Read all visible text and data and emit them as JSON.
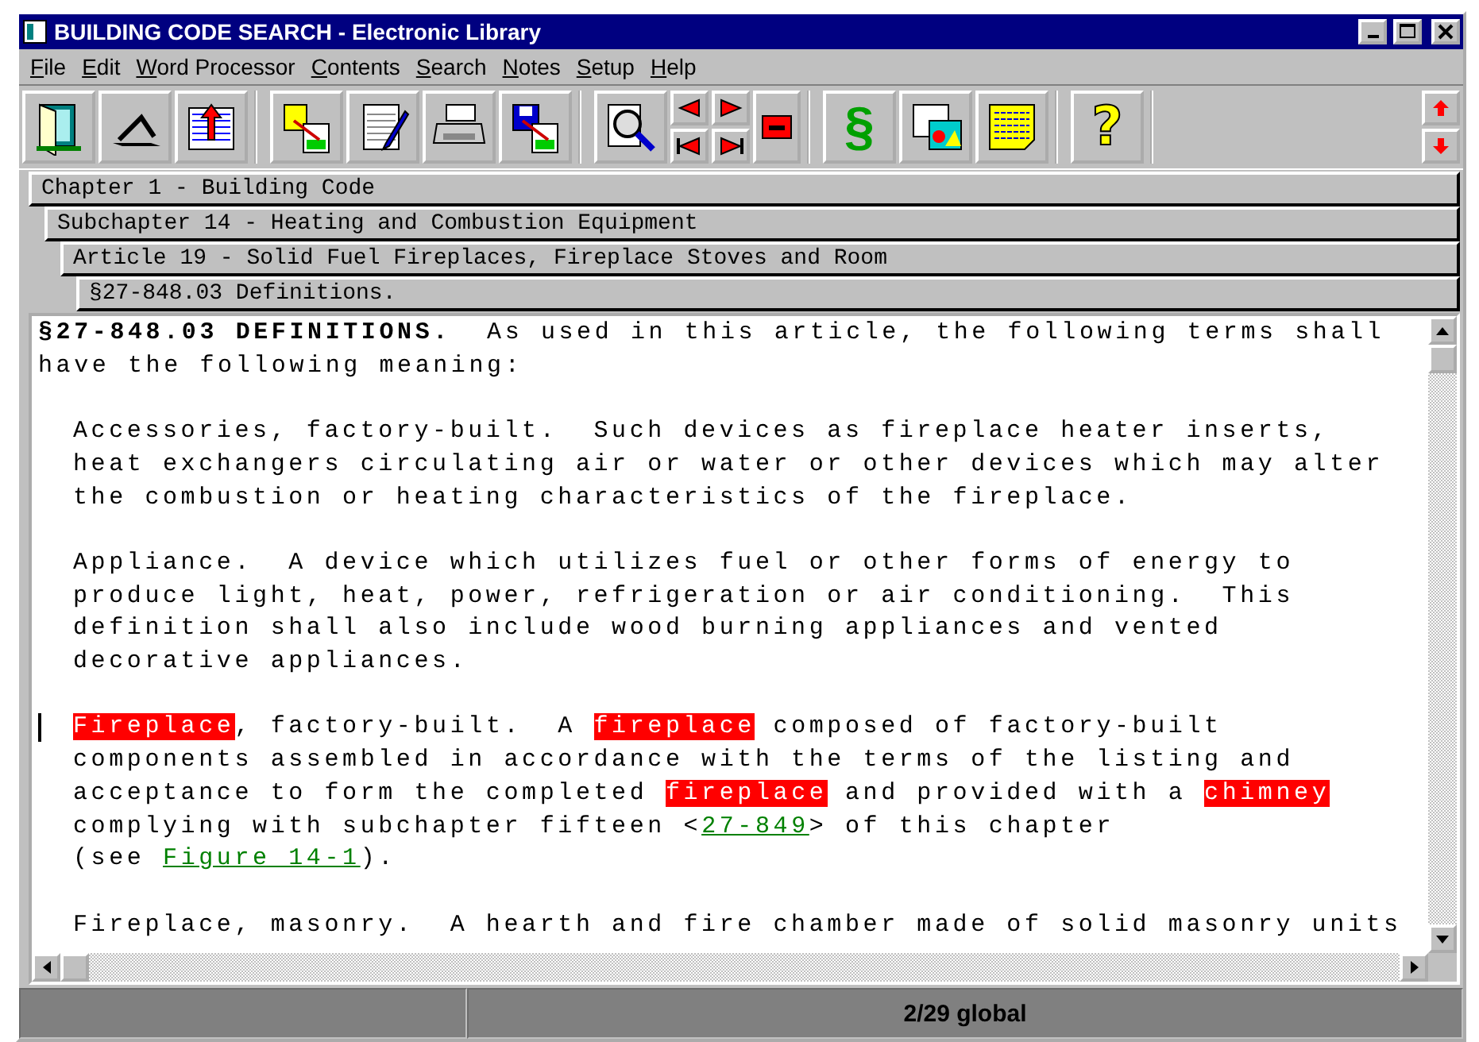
{
  "window": {
    "title": "BUILDING CODE SEARCH - Electronic Library"
  },
  "menu": [
    "File",
    "Edit",
    "Word Processor",
    "Contents",
    "Search",
    "Notes",
    "Setup",
    "Help"
  ],
  "toolbar": {
    "section_button": "§",
    "help_button": "?"
  },
  "breadcrumbs": [
    {
      "label": "Chapter 1 - Building Code",
      "children": [
        {
          "label": "Subchapter 14 - Heating and Combustion Equipment",
          "children": [
            {
              "label": "Article 19 - Solid Fuel Fireplaces, Fireplace Stoves and Room",
              "children": [
                {
                  "label": "§27-848.03 Definitions."
                }
              ]
            }
          ]
        }
      ]
    }
  ],
  "document": {
    "paragraphs": [
      {
        "kind": "heading",
        "caret": false,
        "lines": [
          [
            {
              "kind": "bold",
              "text": "§27-848.03 DEFINITIONS."
            },
            {
              "kind": "text",
              "text": "  As used in this article, the following terms shall"
            }
          ],
          [
            {
              "kind": "text",
              "text": "have the following meaning:"
            }
          ]
        ]
      },
      {
        "kind": "definition",
        "caret": false,
        "lines": [
          [
            {
              "kind": "text",
              "text": "Accessories, factory-built.  Such devices as fireplace heater inserts,"
            }
          ],
          [
            {
              "kind": "text",
              "text": "heat exchangers circulating air or water or other devices which may alter"
            }
          ],
          [
            {
              "kind": "text",
              "text": "the combustion or heating characteristics of the fireplace."
            }
          ]
        ]
      },
      {
        "kind": "definition",
        "caret": false,
        "lines": [
          [
            {
              "kind": "text",
              "text": "Appliance.  A device which utilizes fuel or other forms of energy to"
            }
          ],
          [
            {
              "kind": "text",
              "text": "produce light, heat, power, refrigeration or air conditioning.  This"
            }
          ],
          [
            {
              "kind": "text",
              "text": "definition shall also include wood burning appliances and vented"
            }
          ],
          [
            {
              "kind": "text",
              "text": "decorative appliances."
            }
          ]
        ]
      },
      {
        "kind": "definition",
        "caret": true,
        "lines": [
          [
            {
              "kind": "hit",
              "text": "Fireplace"
            },
            {
              "kind": "text",
              "text": ", factory-built.  A "
            },
            {
              "kind": "hit",
              "text": "fireplace"
            },
            {
              "kind": "text",
              "text": " composed of factory-built"
            }
          ],
          [
            {
              "kind": "text",
              "text": "components assembled in accordance with the terms of the listing and"
            }
          ],
          [
            {
              "kind": "text",
              "text": "acceptance to form the completed "
            },
            {
              "kind": "hit",
              "text": "fireplace"
            },
            {
              "kind": "text",
              "text": " and provided with a "
            },
            {
              "kind": "hit",
              "text": "chimney"
            }
          ],
          [
            {
              "kind": "text",
              "text": "complying with subchapter fifteen <"
            },
            {
              "kind": "link",
              "text": "27-849"
            },
            {
              "kind": "text",
              "text": "> of this chapter"
            }
          ],
          [
            {
              "kind": "text",
              "text": "(see "
            },
            {
              "kind": "link",
              "text": "Figure 14-1"
            },
            {
              "kind": "text",
              "text": ")."
            }
          ]
        ]
      },
      {
        "kind": "definition",
        "caret": false,
        "lines": [
          [
            {
              "kind": "text",
              "text": "Fireplace, masonry.  A hearth and fire chamber made of solid masonry units"
            }
          ]
        ]
      }
    ]
  },
  "status_bar": [
    "2/29 global"
  ]
}
